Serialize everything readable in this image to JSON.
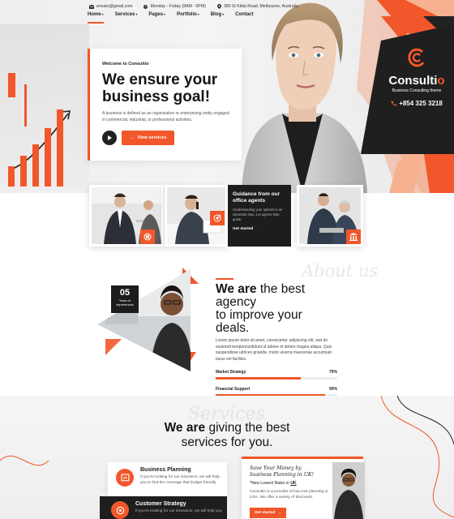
{
  "topbar": {
    "email": "envato@gmail.com",
    "hours": "Monday - Friday (8AM - 5PM)",
    "address": "380 St Kilda Road, Melbourne, Australia"
  },
  "nav": [
    {
      "label": "Home",
      "dropdown": true,
      "active": true
    },
    {
      "label": "Services",
      "dropdown": true
    },
    {
      "label": "Pages",
      "dropdown": true
    },
    {
      "label": "Portfolio",
      "dropdown": true
    },
    {
      "label": "Blog",
      "dropdown": true
    },
    {
      "label": "Contact",
      "dropdown": false
    }
  ],
  "hero": {
    "welcome": "Welcome to Consultio",
    "heading_line1": "We ensure your",
    "heading_line2": "business goal!",
    "body": "A business is defined as an organization or enterprising entity engaged in commercial, industrial, or professional activities.",
    "cta": "View services"
  },
  "brand": {
    "name_main": "Consulti",
    "name_accent": "o",
    "tagline": "Business Consulting theme",
    "phone": "+854 325 3218"
  },
  "feature": {
    "title": "Guidance from our office agents",
    "body": "Understanding your options is an important step. Let agents help guide.",
    "link": "Get started"
  },
  "about": {
    "watermark": "About us",
    "badge_number": "05",
    "badge_text": "Years of experiences",
    "heading_bold": "We are",
    "heading_rest_1": " the best agency",
    "heading_line2": "to improve your deals.",
    "body": "Lorem ipsum dolor sit amet, consectetur adipiscing elit, sed do eiusmod temporincididunt ut labore et dolore magna aliqua. Quis suspendisse ultrices gravida. modo viverra maecenas accumsan lacus vel facilisis.",
    "skills": [
      {
        "label": "Market Strategy",
        "value_text": "70%",
        "value": 0.7
      },
      {
        "label": "Financial Support",
        "value_text": "90%",
        "value": 0.9
      }
    ]
  },
  "services": {
    "watermark": "Services",
    "title_bold": "We are",
    "title_rest": " giving the best",
    "title_line2": "services for you.",
    "cards": [
      {
        "title": "Business Planning",
        "body": "If you're looking for car insurance, we will help you to find the coverage that budget friendly."
      },
      {
        "title": "Customer Strategy",
        "body": "If you're looking for car insurance, we will help you"
      }
    ],
    "promo": {
      "title": "Save Your Money by business Planning in UK!",
      "sub_prefix": "*New Lowest Rates in ",
      "sub_bold": "UK",
      "body": "Consultio is a provider of low-cost planning in USA. We offer a variety of discounts.",
      "button": "Get started"
    }
  },
  "colors": {
    "accent": "#f1572a",
    "dark": "#1d1d1d"
  }
}
